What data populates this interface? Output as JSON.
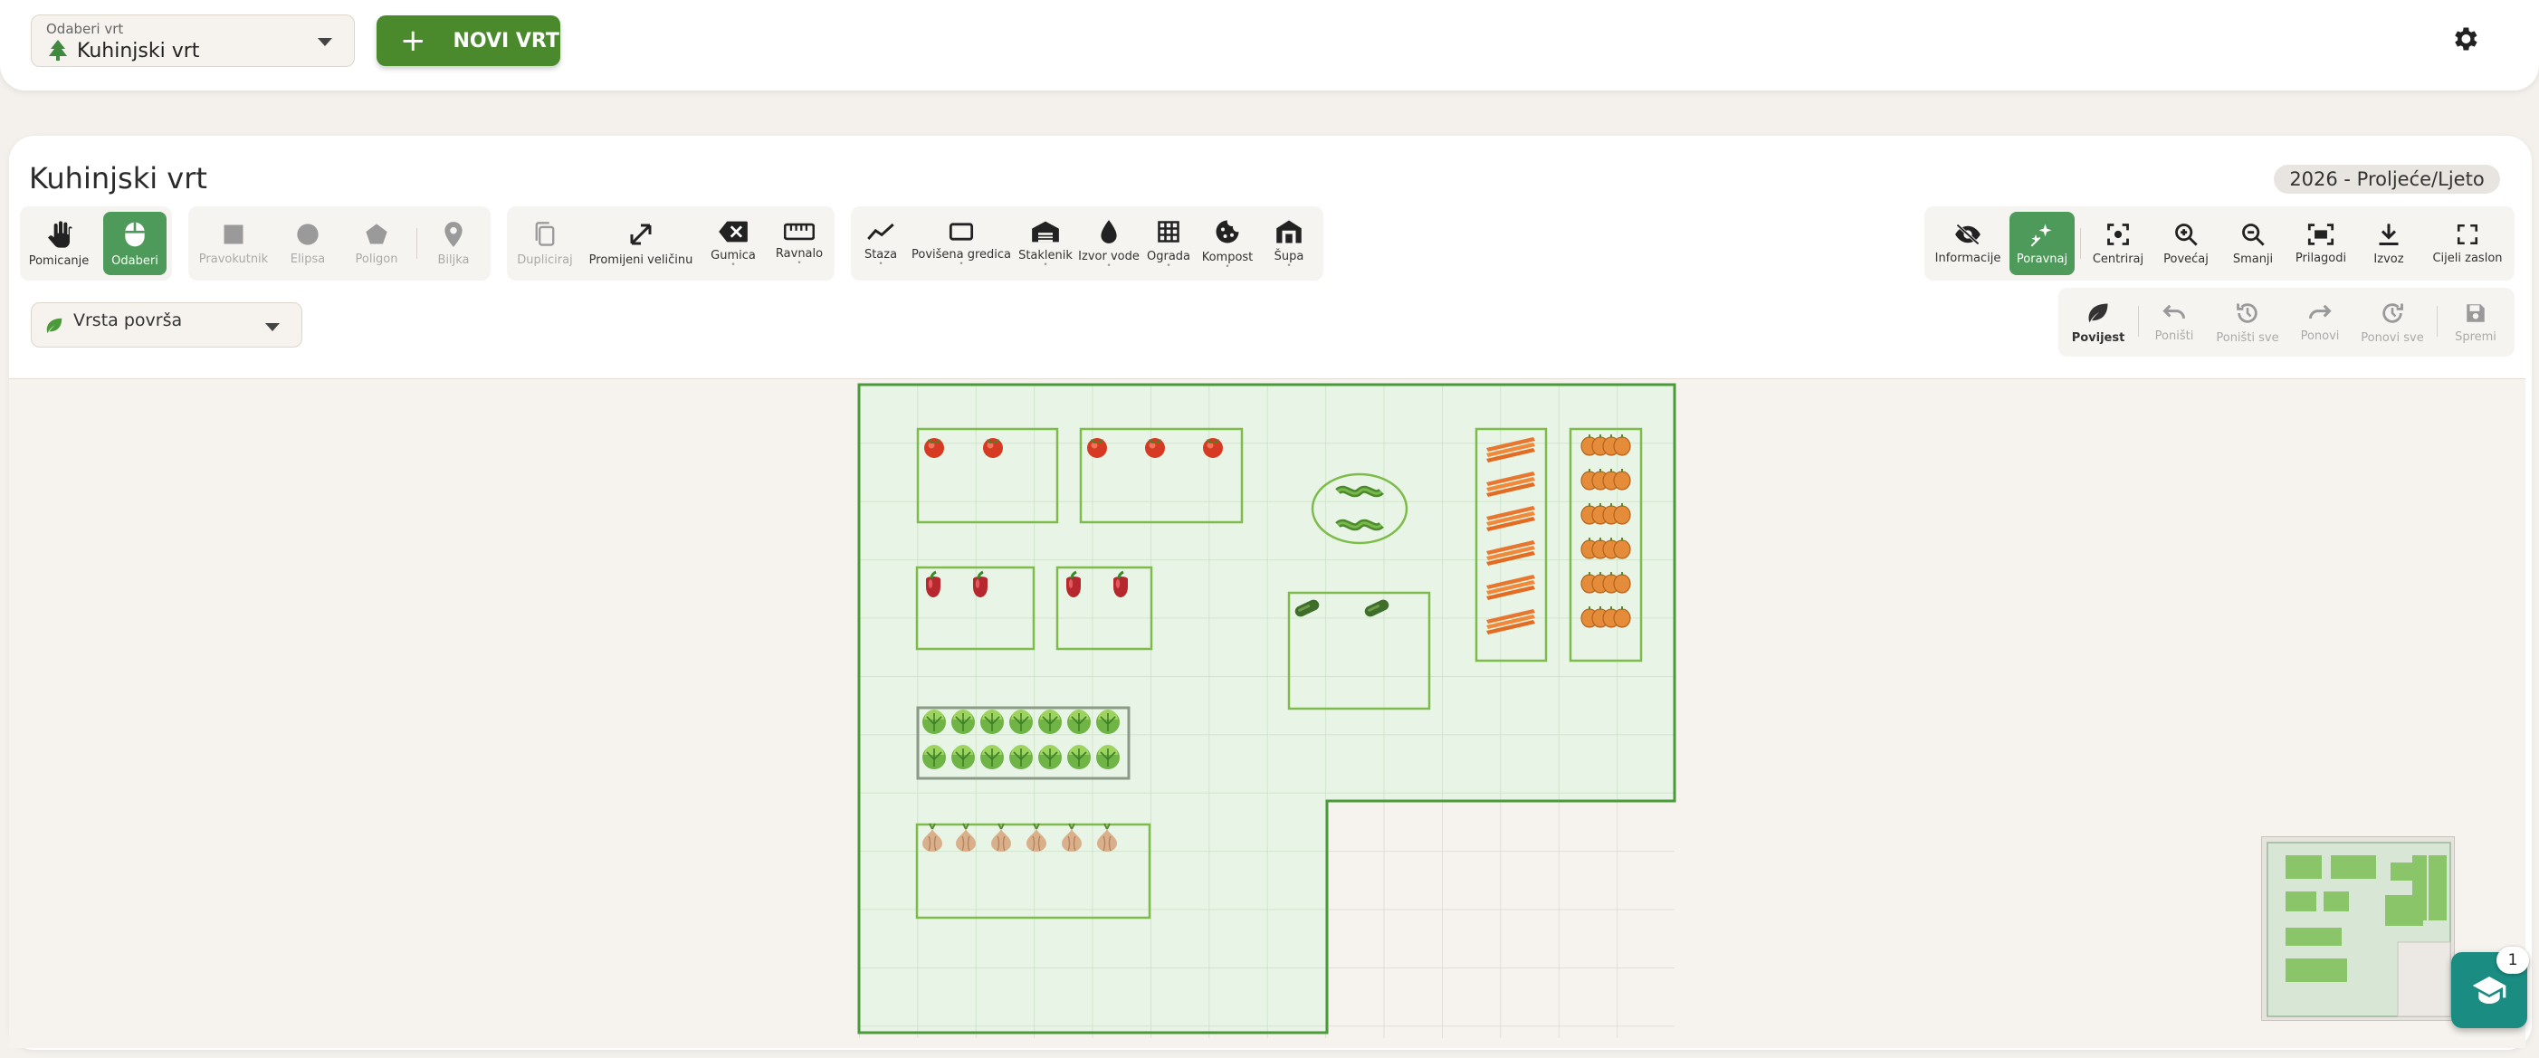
{
  "header": {
    "garden_select_label": "Odaberi vrt",
    "garden_select_value": "Kuhinjski vrt",
    "new_garden_label": "NOVI VRT"
  },
  "workspace": {
    "title": "Kuhinjski vrt",
    "season": "2026 - Proljeće/Ljeto"
  },
  "toolbar": {
    "nav": {
      "pan": "Pomicanje",
      "select": "Odaberi"
    },
    "shapes": {
      "rect": "Pravokutnik",
      "ellipse": "Elipsa",
      "polygon": "Poligon",
      "plant": "Biljka"
    },
    "edit": {
      "duplicate": "Dupliciraj",
      "resize": "Promijeni veličinu",
      "eraser": "Gumica",
      "ruler": "Ravnalo"
    },
    "objects": {
      "path": "Staza",
      "raised_bed": "Povišena gredica",
      "greenhouse": "Staklenik",
      "water": "Izvor vode",
      "fence": "Ograda",
      "compost": "Kompost",
      "shed": "Šupa"
    },
    "view": {
      "info": "Informacije",
      "align": "Poravnaj",
      "center": "Centriraj",
      "zoom_in": "Povećaj",
      "zoom_out": "Smanji",
      "fit": "Prilagodi",
      "export": "Izvoz",
      "fullscreen": "Cijeli zaslon"
    },
    "history": {
      "history": "Povijest",
      "undo": "Poništi",
      "undo_all": "Poništi sve",
      "redo": "Ponovi",
      "redo_all": "Ponovi sve",
      "save": "Spremi"
    }
  },
  "surface_select_value": "Vrsta površa",
  "help_badge": "1",
  "colors": {
    "accent": "#4a8a2c",
    "active_tool": "#4e9a5a",
    "garden_fill": "#e8f5e6",
    "garden_border": "#4a9a3a",
    "bed_border": "#7dbb4a",
    "help_fab": "#1a8c82"
  },
  "icons": {
    "garden": "tree-icon",
    "settings": "gear-icon",
    "help": "graduation-cap-icon"
  }
}
